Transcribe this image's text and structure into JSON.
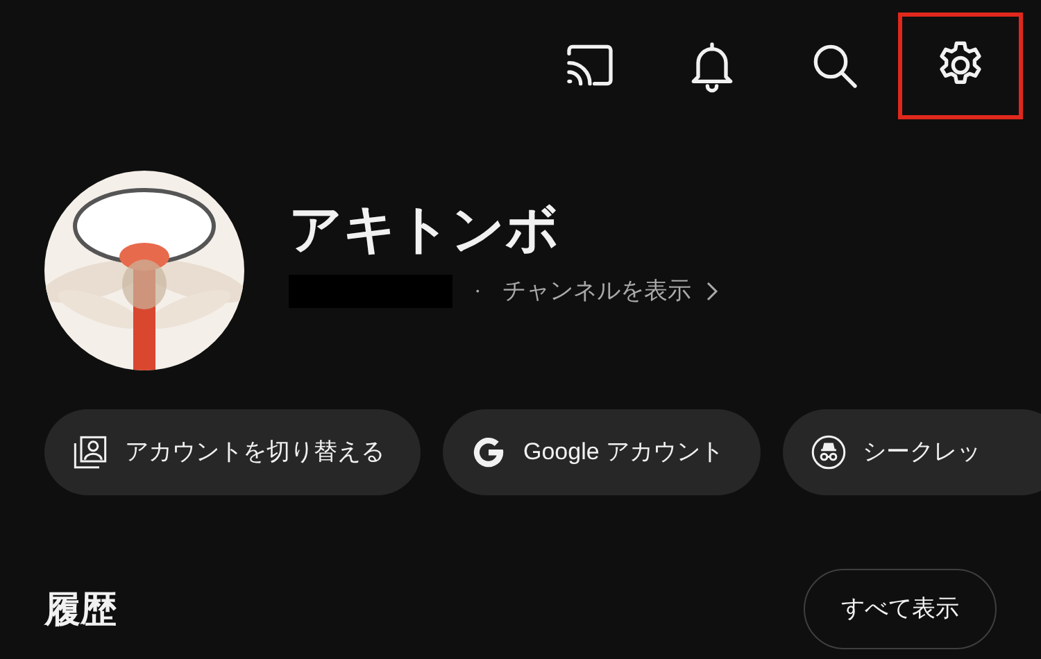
{
  "toolbar": [
    {
      "kind": "cast",
      "highlighted": false
    },
    {
      "kind": "bell",
      "highlighted": false
    },
    {
      "kind": "search",
      "highlighted": false
    },
    {
      "kind": "settings",
      "highlighted": true
    }
  ],
  "profile": {
    "name": "アキトンボ",
    "separator": "・",
    "channel_link": "チャンネルを表示"
  },
  "chips": [
    {
      "kind": "switch-account",
      "label": "アカウントを切り替える"
    },
    {
      "kind": "google",
      "label": "Google アカウント"
    },
    {
      "kind": "incognito",
      "label": "シークレッ"
    }
  ],
  "history": {
    "title": "履歴",
    "view_all": "すべて表示"
  }
}
